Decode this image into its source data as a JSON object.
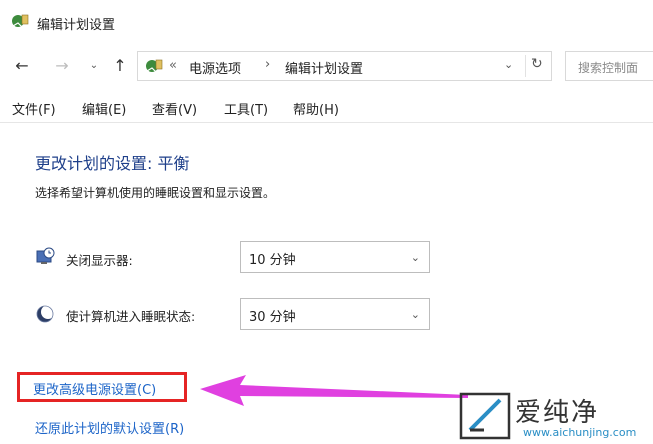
{
  "window": {
    "title": "编辑计划设置"
  },
  "nav": {
    "back_icon": "arrow-left-icon",
    "forward_icon": "arrow-right-icon",
    "recent_icon": "chevron-down-icon",
    "up_icon": "arrow-up-icon"
  },
  "address": {
    "overflow": "«",
    "crumbs": [
      "电源选项",
      "编辑计划设置"
    ],
    "separator": "›"
  },
  "search": {
    "placeholder": "搜索控制面"
  },
  "menu": [
    "文件(F)",
    "编辑(E)",
    "查看(V)",
    "工具(T)",
    "帮助(H)"
  ],
  "content": {
    "heading": "更改计划的设置: 平衡",
    "subtitle": "选择希望计算机使用的睡眠设置和显示设置。",
    "settings": [
      {
        "label": "关闭显示器:",
        "value": "10 分钟",
        "icon": "monitor-clock-icon"
      },
      {
        "label": "使计算机进入睡眠状态:",
        "value": "30 分钟",
        "icon": "moon-icon"
      }
    ],
    "links": {
      "advanced": "更改高级电源设置(C)",
      "restore": "还原此计划的默认设置(R)"
    }
  },
  "watermark": {
    "text": "爱纯净",
    "url": "www.aichunjing.com"
  },
  "colors": {
    "heading": "#1e3f8a",
    "link": "#1c64c8",
    "highlight": "#e52424",
    "arrow": "#e040e0"
  }
}
